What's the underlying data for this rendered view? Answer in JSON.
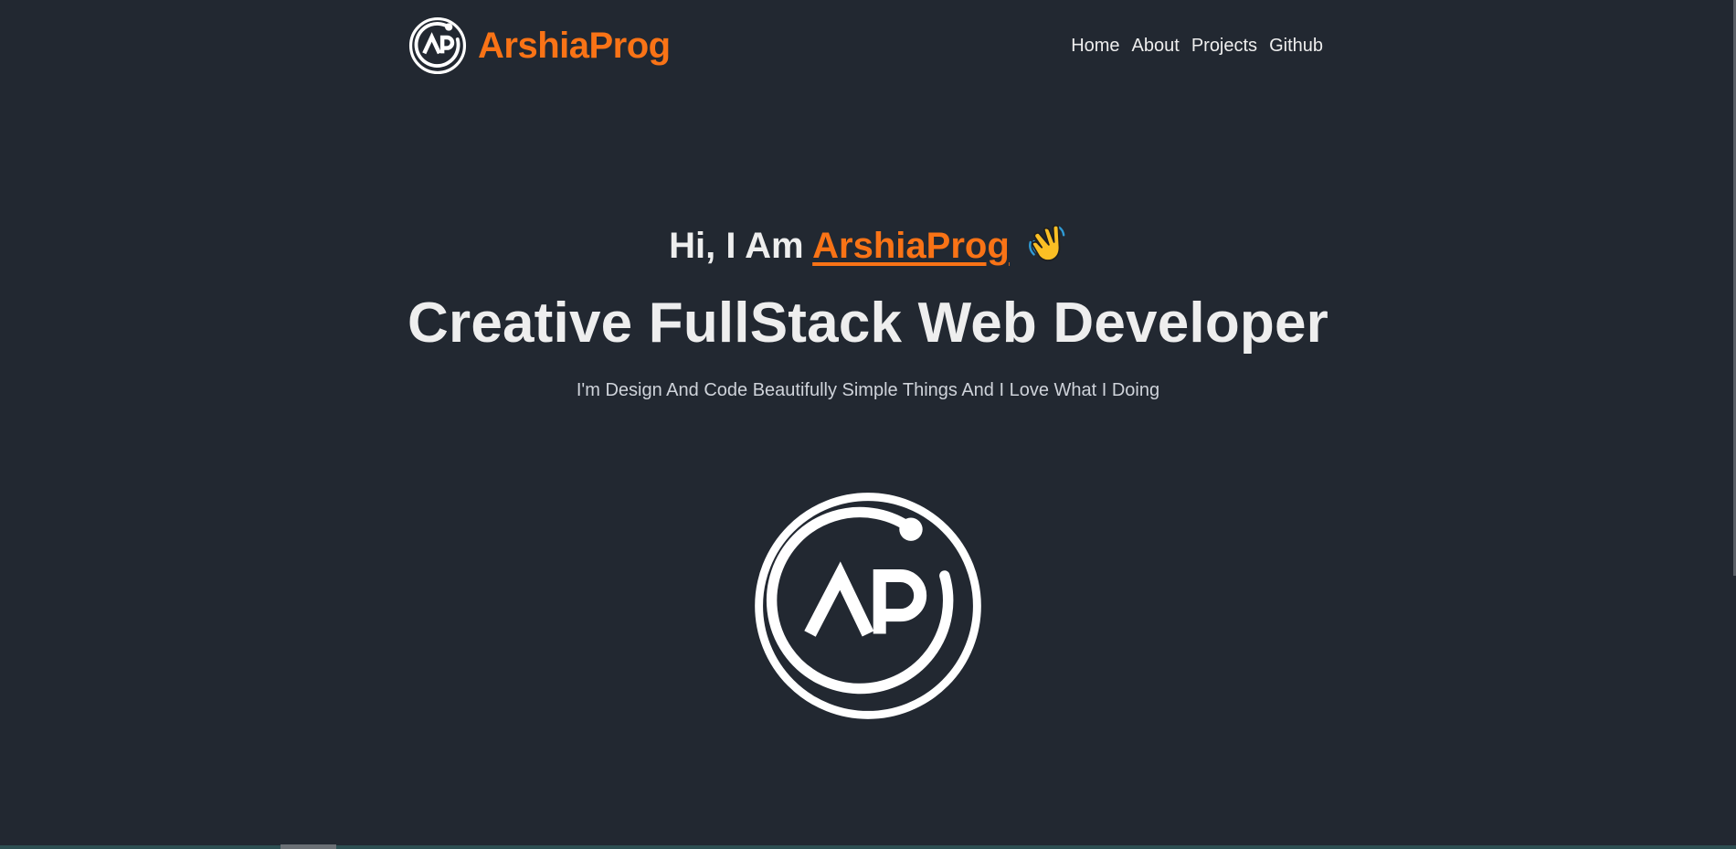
{
  "brand": {
    "name": "ArshiaProg",
    "logo_icon": "ap-circle-logo-icon",
    "accent_color": "#f97316"
  },
  "nav": {
    "items": [
      {
        "label": "Home"
      },
      {
        "label": "About"
      },
      {
        "label": "Projects"
      },
      {
        "label": "Github"
      }
    ]
  },
  "hero": {
    "greeting_prefix": "Hi, I Am ",
    "greeting_name": "ArshiaProg",
    "greeting_icon": "waving-hand-icon",
    "headline": "Creative FullStack Web Developer",
    "tagline": "I'm Design And Code Beautifully Simple Things And I Love What I Doing",
    "logo_icon": "ap-circle-logo-icon"
  },
  "theme": {
    "background": "#222831",
    "text": "#eeeeee"
  }
}
